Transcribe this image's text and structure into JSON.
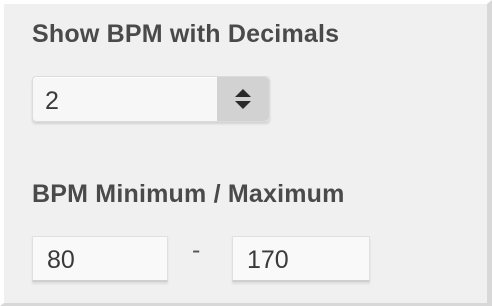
{
  "decimals_section": {
    "label": "Show BPM with Decimals",
    "selected_value": "2"
  },
  "bpm_range_section": {
    "label": "BPM Minimum / Maximum",
    "minimum_value": "80",
    "separator": "-",
    "maximum_value": "170"
  },
  "icons": {
    "stepper": "up-down-chevron-icon"
  }
}
